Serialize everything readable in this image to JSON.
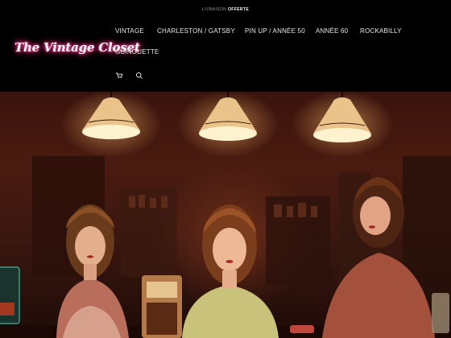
{
  "topbar": {
    "text_prefix": "LIVRAISON ",
    "text_bold": "OFFERTE"
  },
  "logo": {
    "text": "The Vintage Closet",
    "glow_color": "#ff2e88"
  },
  "nav": {
    "items": [
      {
        "label": "VINTAGE"
      },
      {
        "label": "CHARLESTON / GATSBY"
      },
      {
        "label": "PIN UP / ANNÉE 50"
      },
      {
        "label": "ANNÉE 60"
      },
      {
        "label": "ROCKABILLY"
      },
      {
        "label": "GUINGUETTE"
      }
    ]
  },
  "icons": {
    "cart": "cart-icon",
    "search": "search-icon"
  },
  "hero": {
    "description_icon": "hero-banner-image"
  }
}
